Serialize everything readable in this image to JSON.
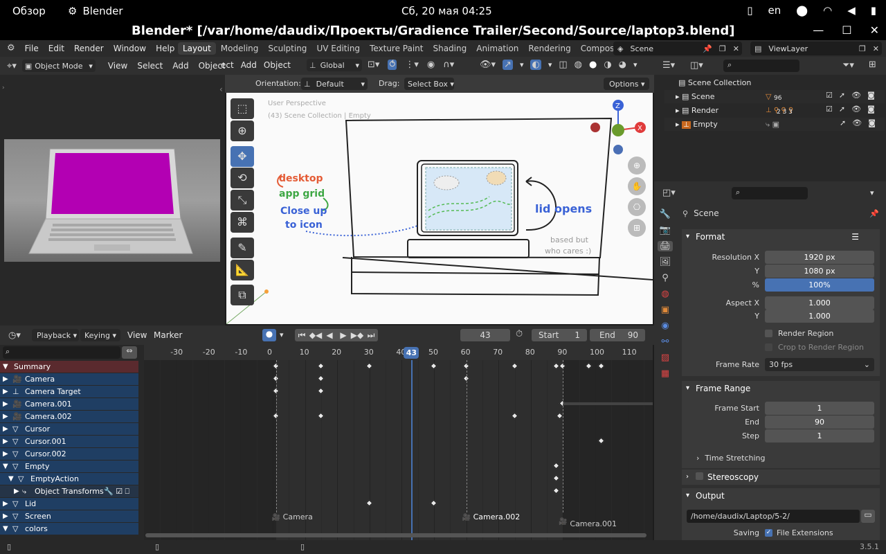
{
  "gnome": {
    "activities": "Обзор",
    "app": "Blender",
    "clock": "Сб, 20 мая  04:25",
    "lang": "en"
  },
  "window": {
    "title": "Blender* [/var/home/daudix/Проекты/Gradience Trailer/Second/Source/laptop3.blend]"
  },
  "menu": {
    "file": "File",
    "edit": "Edit",
    "render": "Render",
    "window": "Window",
    "help": "Help"
  },
  "workspaces": [
    "Layout",
    "Modeling",
    "Sculpting",
    "UV Editing",
    "Texture Paint",
    "Shading",
    "Animation",
    "Rendering",
    "Compositing"
  ],
  "scene": {
    "label": "Scene",
    "viewlayer": "ViewLayer"
  },
  "viewport_header": {
    "mode": "Object Mode",
    "view": "View",
    "select": "Select",
    "add": "Add",
    "object": "Object",
    "t1": "ect",
    "add2": "Add",
    "object2": "Object",
    "transform": "Global",
    "orientation_label": "Orientation:",
    "orientation": "Default",
    "drag_label": "Drag:",
    "drag": "Select Box",
    "options": "Options"
  },
  "viewport": {
    "persp": "User Perspective",
    "coll": "(43) Scene Collection | Empty",
    "notes": {
      "desktop": "desktop",
      "appgrid": "app grid",
      "close": "Close up",
      "toicon": "to icon",
      "lid": "lid opens",
      "based": "based but",
      "who": "who cares :)"
    }
  },
  "outliner": {
    "root": "Scene Collection",
    "items": [
      {
        "name": "Scene",
        "badge": "96"
      },
      {
        "name": "Render",
        "badge": "2  3  3"
      },
      {
        "name": "Empty",
        "badge": ""
      }
    ]
  },
  "props": {
    "context": "Scene",
    "format": "Format",
    "resx_l": "Resolution X",
    "resx": "1920 px",
    "resy_l": "Y",
    "resy": "1080 px",
    "pct_l": "%",
    "pct": "100%",
    "pct_value": 1.0,
    "aspx_l": "Aspect X",
    "aspx": "1.000",
    "aspy_l": "Y",
    "aspy": "1.000",
    "region": "Render Region",
    "crop": "Crop to Render Region",
    "fps_l": "Frame Rate",
    "fps": "30 fps",
    "frame_range": "Frame Range",
    "fstart_l": "Frame Start",
    "fstart": "1",
    "fend_l": "End",
    "fend": "90",
    "step_l": "Step",
    "step": "1",
    "time_stretch": "Time Stretching",
    "stereo": "Stereoscopy",
    "output": "Output",
    "path": "/home/daudix/Laptop/5-2/",
    "saving": "Saving",
    "fileext": "File Extensions"
  },
  "timeline": {
    "playback": "Playback",
    "keying": "Keying",
    "view": "View",
    "marker": "Marker",
    "current": "43",
    "start_l": "Start",
    "start": "1",
    "end_l": "End",
    "end": "90",
    "ticks": [
      "-30",
      "-20",
      "-10",
      "0",
      "10",
      "20",
      "30",
      "40",
      "50",
      "60",
      "70",
      "80",
      "90",
      "100",
      "110"
    ],
    "markers": [
      {
        "name": "Camera",
        "frame": 0
      },
      {
        "name": "Camera.002",
        "frame": 60
      },
      {
        "name": "Camera.001",
        "frame": 90
      }
    ]
  },
  "channels": [
    "Summary",
    "Camera",
    "Camera Target",
    "Camera.001",
    "Camera.002",
    "Cursor",
    "Cursor.001",
    "Cursor.002",
    "Empty",
    "EmptyAction",
    "Object Transforms",
    "Lid",
    "Screen",
    "colors"
  ],
  "version": "3.5.1"
}
